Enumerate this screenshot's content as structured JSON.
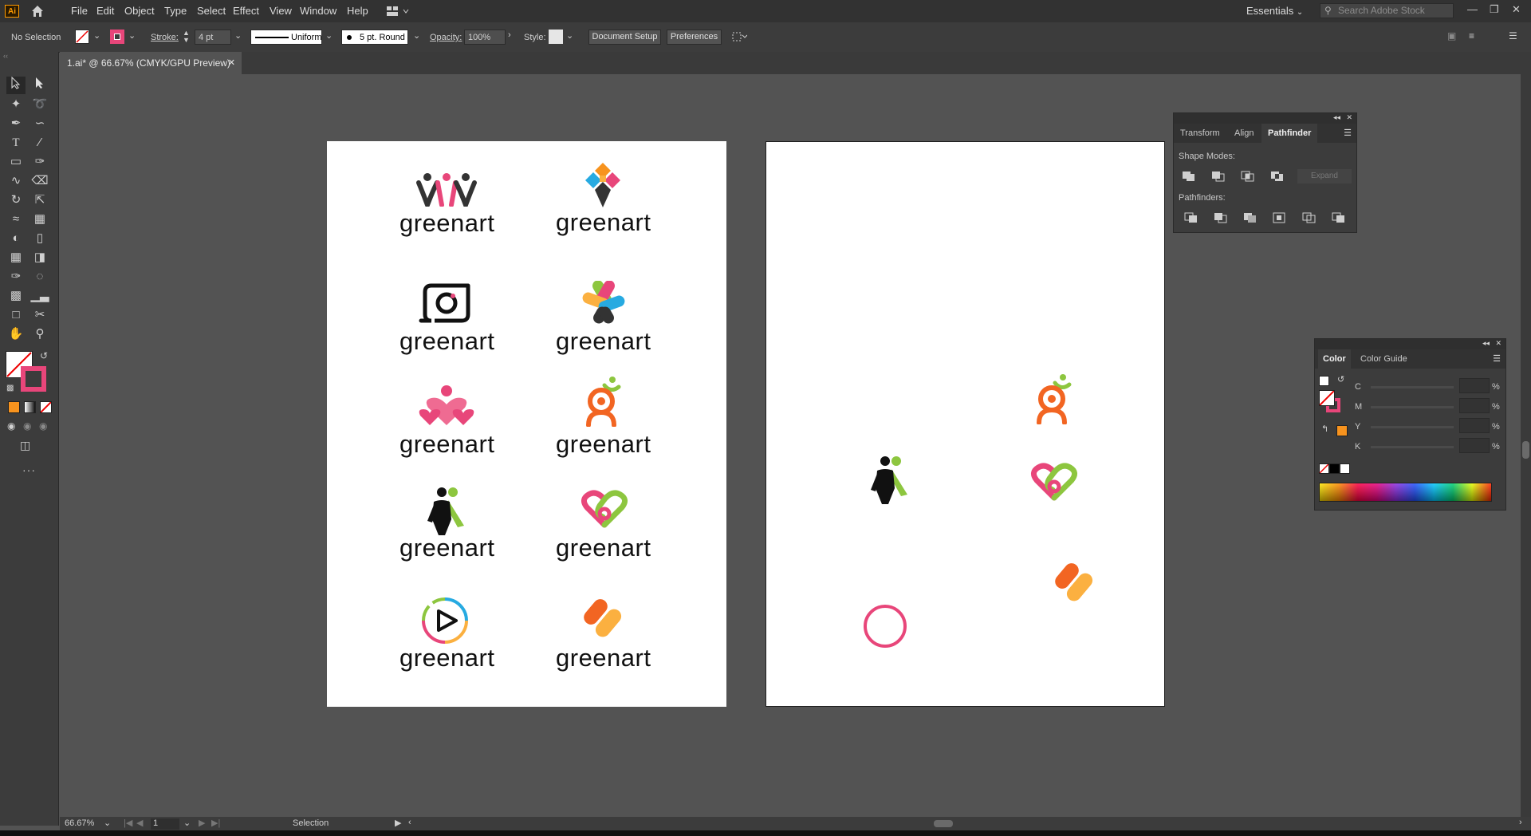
{
  "app": {
    "logo": "Ai"
  },
  "menu": [
    "File",
    "Edit",
    "Object",
    "Type",
    "Select",
    "Effect",
    "View",
    "Window",
    "Help"
  ],
  "workspace": "Essentials",
  "stock_search": {
    "placeholder": "Search Adobe Stock"
  },
  "control": {
    "selection": "No Selection",
    "stroke_label": "Stroke:",
    "stroke_value": "4 pt",
    "stroke_profile": "Uniform",
    "brush": "5 pt. Round",
    "opacity_label": "Opacity:",
    "opacity_value": "100%",
    "style_label": "Style:",
    "document_setup": "Document Setup",
    "preferences": "Preferences"
  },
  "document_tab": {
    "title": "1.ai* @ 66.67% (CMYK/GPU Preview)"
  },
  "artboard1": {
    "logos": [
      {
        "icon": "people-logo-icon",
        "word": "greenart"
      },
      {
        "icon": "diamond-logo-icon",
        "word": "greenart"
      },
      {
        "icon": "camera-logo-icon",
        "word": "greenart"
      },
      {
        "icon": "cross-logo-icon",
        "word": "greenart"
      },
      {
        "icon": "hearts-logo-icon",
        "word": "greenart"
      },
      {
        "icon": "person-logo-icon",
        "word": "greenart"
      },
      {
        "icon": "couple-logo-icon",
        "word": "greenart"
      },
      {
        "icon": "heart-loop-logo-icon",
        "word": "greenart"
      },
      {
        "icon": "play-logo-icon",
        "word": "greenart"
      },
      {
        "icon": "stripes-logo-icon",
        "word": "greenart"
      }
    ]
  },
  "pathfinder_panel": {
    "tabs": [
      "Transform",
      "Align",
      "Pathfinder"
    ],
    "active_tab": "Pathfinder",
    "shape_modes_label": "Shape Modes:",
    "expand": "Expand",
    "pathfinders_label": "Pathfinders:"
  },
  "color_panel": {
    "tabs": [
      "Color",
      "Color Guide"
    ],
    "channels": [
      "C",
      "M",
      "Y",
      "K"
    ],
    "percent": "%",
    "accent_orange": "#f7931e",
    "fill_color": "#e8467a"
  },
  "status": {
    "zoom": "66.67%",
    "artboard_number": "1",
    "tool": "Selection"
  },
  "colors": {
    "pink": "#e8467a",
    "orange": "#f26522",
    "green": "#8dc63f",
    "yellow": "#fbb040",
    "blue": "#27aae1"
  }
}
